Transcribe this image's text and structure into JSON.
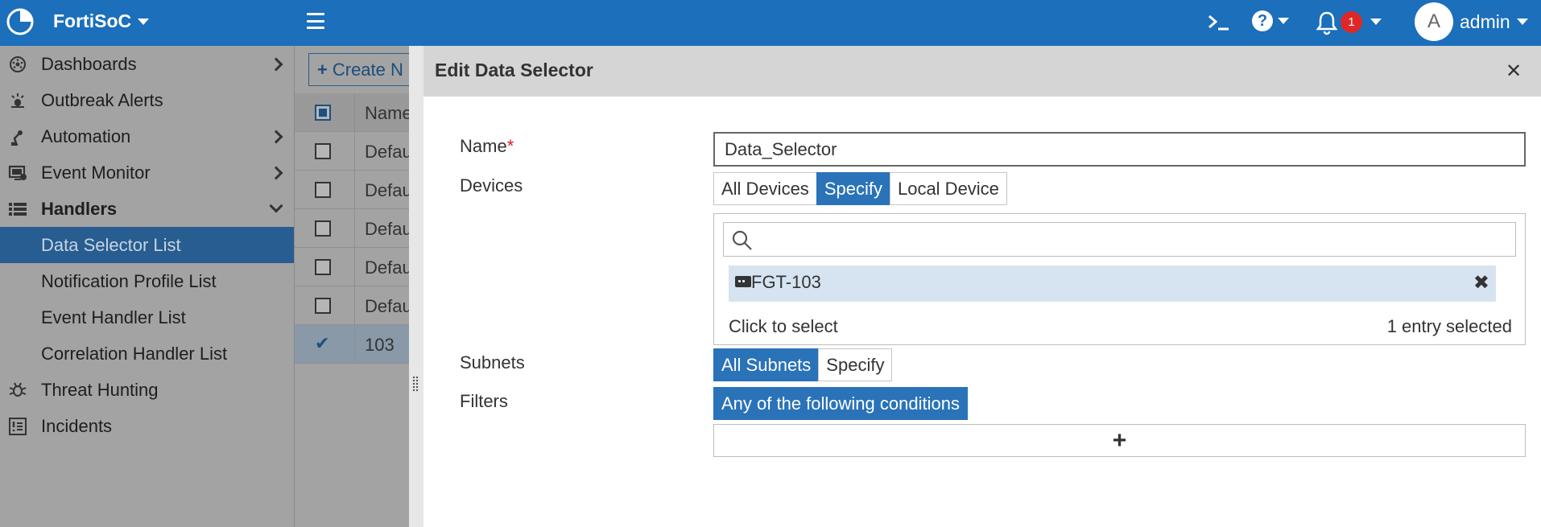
{
  "topbar": {
    "brand": "FortiSoC",
    "badge_count": "1",
    "avatar_initial": "A",
    "username": "admin",
    "bg_color": "#1b6fbb"
  },
  "sidebar": {
    "items": [
      {
        "label": "Dashboards",
        "icon": "dashboard-icon"
      },
      {
        "label": "Outbreak Alerts",
        "icon": "outbreak-icon"
      },
      {
        "label": "Automation",
        "icon": "automation-icon"
      },
      {
        "label": "Event Monitor",
        "icon": "monitor-icon"
      },
      {
        "label": "Handlers",
        "icon": "list-icon"
      },
      {
        "label": "Data Selector List"
      },
      {
        "label": "Notification Profile List"
      },
      {
        "label": "Event Handler List"
      },
      {
        "label": "Correlation Handler List"
      },
      {
        "label": "Threat Hunting",
        "icon": "bug-icon"
      },
      {
        "label": "Incidents",
        "icon": "incidents-icon"
      }
    ],
    "active_color": "#275d91"
  },
  "list": {
    "create_label": "Create N",
    "header_label": "Name",
    "rows": [
      "Defau",
      "Defau",
      "Defau",
      "Defau",
      "Defau",
      "103"
    ]
  },
  "panel": {
    "title": "Edit Data Selector",
    "name_label": "Name",
    "name_required_mark": "*",
    "name_value": "Data_Selector",
    "devices_label": "Devices",
    "devices_options": [
      "All Devices",
      "Specify",
      "Local Device"
    ],
    "devices_selected": "Specify",
    "selected_device": "FGT-103",
    "click_to_select": "Click to select",
    "entries_selected": "1 entry selected",
    "subnets_label": "Subnets",
    "subnets_options": [
      "All Subnets",
      "Specify"
    ],
    "subnets_selected": "All Subnets",
    "filters_label": "Filters",
    "filters_condition": "Any of the following conditions",
    "accent_color": "#2a73b8"
  }
}
